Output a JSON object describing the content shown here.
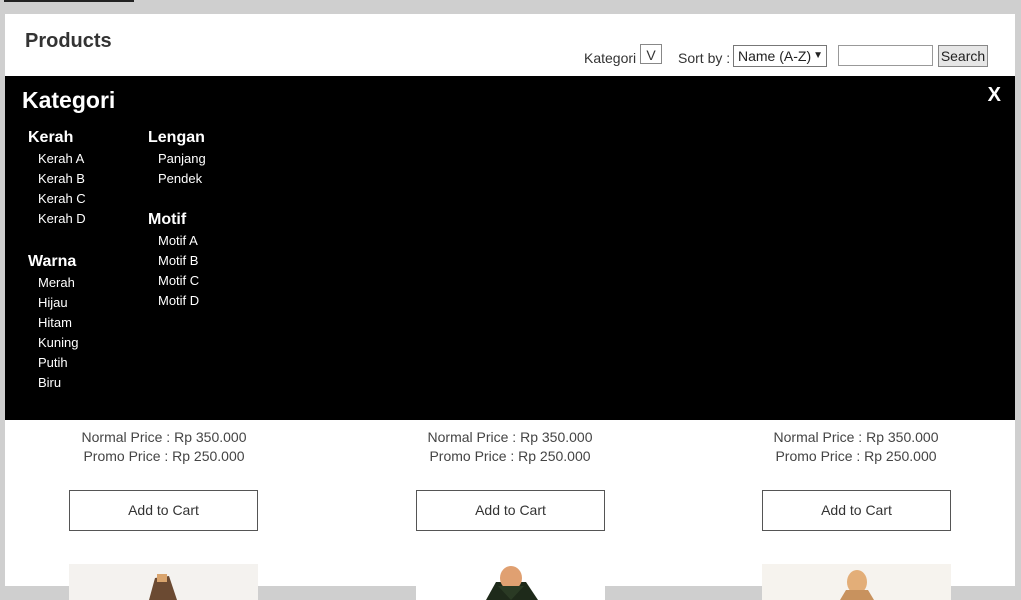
{
  "page_title": "Products",
  "toolbar": {
    "kategori_label": "Kategori",
    "kategori_toggle": "V",
    "sort_label": "Sort by :",
    "sort_value": "Name (A-Z)",
    "search_value": "",
    "search_button": "Search"
  },
  "overlay": {
    "title": "Kategori",
    "close": "X",
    "groups": [
      {
        "title": "Kerah",
        "items": [
          "Kerah A",
          "Kerah B",
          "Kerah C",
          "Kerah D"
        ]
      },
      {
        "title": "Warna",
        "items": [
          "Merah",
          "Hijau",
          "Hitam",
          "Kuning",
          "Putih",
          "Biru"
        ]
      },
      {
        "title": "Lengan",
        "items": [
          "Panjang",
          "Pendek"
        ]
      },
      {
        "title": "Motif",
        "items": [
          "Motif A",
          "Motif B",
          "Motif C",
          "Motif D"
        ]
      }
    ]
  },
  "products": [
    {
      "normal_price": "Normal Price : Rp 350.000",
      "promo_price": "Promo Price : Rp 250.000",
      "cart_label": "Add to Cart"
    },
    {
      "normal_price": "Normal Price : Rp 350.000",
      "promo_price": "Promo Price : Rp 250.000",
      "cart_label": "Add to Cart"
    },
    {
      "normal_price": "Normal Price : Rp 350.000",
      "promo_price": "Promo Price : Rp 250.000",
      "cart_label": "Add to Cart"
    }
  ]
}
